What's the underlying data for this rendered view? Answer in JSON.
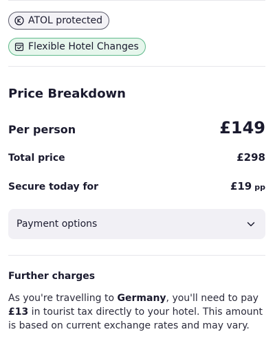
{
  "badges": {
    "atol_label": "ATOL protected",
    "flex_label": "Flexible Hotel Changes"
  },
  "icons": {
    "atol": "atol-shield-icon",
    "flex": "calendar-check-icon",
    "chevron": "chevron-down-icon"
  },
  "price": {
    "title": "Price Breakdown",
    "per_person_label": "Per person",
    "per_person_value": "£149",
    "total_label": "Total price",
    "total_value": "£298",
    "secure_label": "Secure today for",
    "secure_value": "£19",
    "secure_unit": "pp"
  },
  "payment": {
    "label": "Payment options"
  },
  "further": {
    "title": "Further charges",
    "text_1": "As you're travelling to ",
    "country": "Germany",
    "text_2": ", you'll need to pay ",
    "amount": "£13",
    "text_3": " in tourist tax directly to your hotel. This amount is based on current exchange rates and may vary."
  },
  "colors": {
    "text": "#1a1a2e",
    "flex_bg": "#e6f6ec",
    "flex_border": "#5fb98a",
    "payment_bg": "#f1f0f5"
  }
}
